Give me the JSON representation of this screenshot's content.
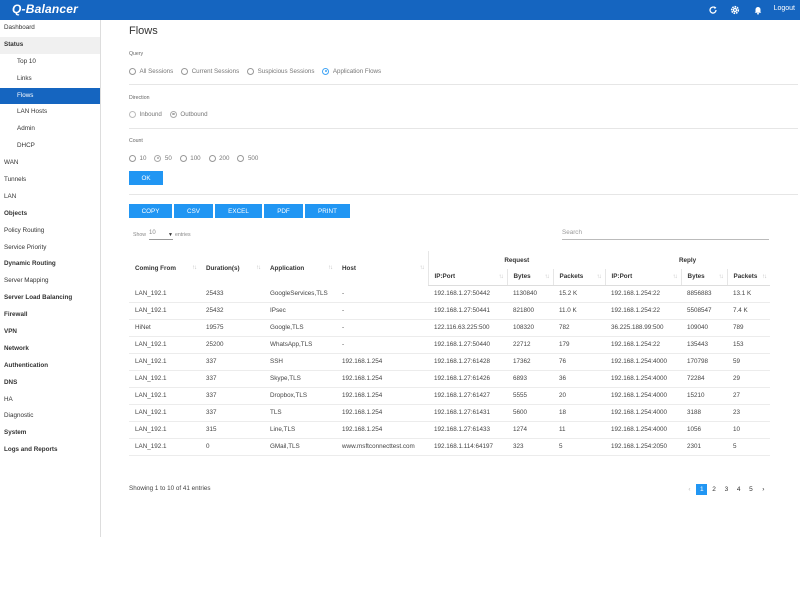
{
  "app": {
    "logo": "Q-Balancer",
    "logout": "Logout"
  },
  "colors": {
    "brand": "#1565c0",
    "accent": "#2196f3"
  },
  "sidebar": {
    "items": [
      {
        "label": "Dashboard"
      },
      {
        "label": "Status"
      },
      {
        "label": "Top 10"
      },
      {
        "label": "Links"
      },
      {
        "label": "Flows"
      },
      {
        "label": "LAN Hosts"
      },
      {
        "label": "Admin"
      },
      {
        "label": "DHCP"
      },
      {
        "label": "WAN"
      },
      {
        "label": "Tunnels"
      },
      {
        "label": "LAN"
      },
      {
        "label": "Objects"
      },
      {
        "label": "Policy Routing"
      },
      {
        "label": "Service Priority"
      },
      {
        "label": "Dynamic Routing"
      },
      {
        "label": "Server Mapping"
      },
      {
        "label": "Server Load Balancing"
      },
      {
        "label": "Firewall"
      },
      {
        "label": "VPN"
      },
      {
        "label": "Network"
      },
      {
        "label": "Authentication"
      },
      {
        "label": "DNS"
      },
      {
        "label": "HA"
      },
      {
        "label": "Diagnostic"
      },
      {
        "label": "System"
      },
      {
        "label": "Logs and Reports"
      }
    ]
  },
  "page": {
    "title": "Flows"
  },
  "query": {
    "label": "Query",
    "options": [
      "All Sessions",
      "Current Sessions",
      "Suspicious Sessions",
      "Application Flows"
    ],
    "selected": "Application Flows"
  },
  "direction": {
    "label": "Direction",
    "options": [
      "Inbound",
      "Outbound"
    ],
    "selected": "Outbound"
  },
  "count": {
    "label": "Count",
    "options": [
      "10",
      "50",
      "100",
      "200",
      "500"
    ],
    "selected": "50"
  },
  "ok_button": "OK",
  "export_buttons": [
    "COPY",
    "CSV",
    "EXCEL",
    "PDF",
    "PRINT"
  ],
  "table_controls": {
    "show_label": "Show",
    "show_value": "10",
    "entries_label": "entries",
    "search_placeholder": "Search"
  },
  "table": {
    "group_request": "Request",
    "group_reply": "Reply",
    "columns": [
      "Coming From",
      "Duration(s)",
      "Application",
      "Host",
      "IP:Port",
      "Bytes",
      "Packets",
      "IP:Port",
      "Bytes",
      "Packets"
    ],
    "rows": [
      [
        "LAN_192.1",
        "25433",
        "GoogleServices,TLS",
        "-",
        "192.168.1.27:50442",
        "1130840",
        "15.2 K",
        "192.168.1.254:22",
        "8856883",
        "13.1 K"
      ],
      [
        "LAN_192.1",
        "25432",
        "IPsec",
        "-",
        "192.168.1.27:50441",
        "821800",
        "11.0 K",
        "192.168.1.254:22",
        "5508547",
        "7.4 K"
      ],
      [
        "HiNet",
        "19575",
        "Google,TLS",
        "-",
        "122.116.63.225:500",
        "108320",
        "782",
        "36.225.188.99:500",
        "109040",
        "789"
      ],
      [
        "LAN_192.1",
        "25200",
        "WhatsApp,TLS",
        "-",
        "192.168.1.27:50440",
        "22712",
        "179",
        "192.168.1.254:22",
        "135443",
        "153"
      ],
      [
        "LAN_192.1",
        "337",
        "SSH",
        "192.168.1.254",
        "192.168.1.27:61428",
        "17362",
        "76",
        "192.168.1.254:4000",
        "170798",
        "59"
      ],
      [
        "LAN_192.1",
        "337",
        "Skype,TLS",
        "192.168.1.254",
        "192.168.1.27:61426",
        "6893",
        "36",
        "192.168.1.254:4000",
        "72284",
        "29"
      ],
      [
        "LAN_192.1",
        "337",
        "Dropbox,TLS",
        "192.168.1.254",
        "192.168.1.27:61427",
        "5555",
        "20",
        "192.168.1.254:4000",
        "15210",
        "27"
      ],
      [
        "LAN_192.1",
        "337",
        "TLS",
        "192.168.1.254",
        "192.168.1.27:61431",
        "5600",
        "18",
        "192.168.1.254:4000",
        "3188",
        "23"
      ],
      [
        "LAN_192.1",
        "315",
        "Line,TLS",
        "192.168.1.254",
        "192.168.1.27:61433",
        "1274",
        "11",
        "192.168.1.254:4000",
        "1056",
        "10"
      ],
      [
        "LAN_192.1",
        "0",
        "GMail,TLS",
        "www.msftconnecttest.com",
        "192.168.1.114:64197",
        "323",
        "5",
        "192.168.1.254:2050",
        "2301",
        "5"
      ]
    ]
  },
  "footer": {
    "info": "Showing 1 to 10 of 41 entries",
    "pages": [
      "1",
      "2",
      "3",
      "4",
      "5"
    ],
    "current_page": "1"
  }
}
